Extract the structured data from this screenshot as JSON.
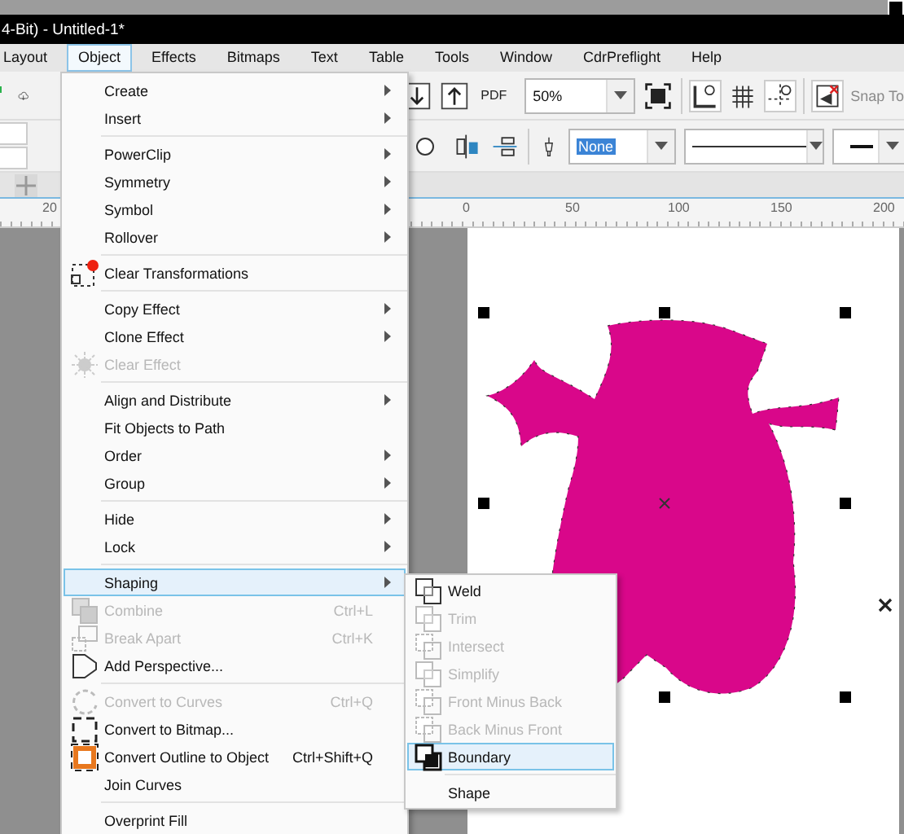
{
  "title_bar": {
    "title": "4-Bit) - Untitled-1*"
  },
  "menu_bar": [
    {
      "label": "Layout",
      "selected": false
    },
    {
      "label": "Object",
      "selected": true
    },
    {
      "label": "Effects",
      "selected": false
    },
    {
      "label": "Bitmaps",
      "selected": false
    },
    {
      "label": "Text",
      "selected": false
    },
    {
      "label": "Table",
      "selected": false
    },
    {
      "label": "Tools",
      "selected": false
    },
    {
      "label": "Window",
      "selected": false
    },
    {
      "label": "CdrPreflight",
      "selected": false
    },
    {
      "label": "Help",
      "selected": false
    }
  ],
  "toolbar": {
    "pdf_label": "PDF",
    "zoom": "50%",
    "snap": {
      "label": "Snap To",
      "disabled": true
    }
  },
  "property_bar": {
    "outline": {
      "value": "None",
      "selected": true
    }
  },
  "ruler": {
    "labels": [
      "20",
      "0",
      "50",
      "100",
      "150",
      "200"
    ]
  },
  "object_menu": {
    "items": [
      {
        "kind": "item",
        "label": "Create",
        "submenu": true,
        "disabled": false,
        "selected": false
      },
      {
        "kind": "item",
        "label": "Insert",
        "submenu": true,
        "disabled": false,
        "selected": false
      },
      {
        "kind": "separator"
      },
      {
        "kind": "item",
        "label": "PowerClip",
        "submenu": true,
        "disabled": false,
        "selected": false
      },
      {
        "kind": "item",
        "label": "Symmetry",
        "submenu": true,
        "disabled": false,
        "selected": false
      },
      {
        "kind": "item",
        "label": "Symbol",
        "submenu": true,
        "disabled": false,
        "selected": false
      },
      {
        "kind": "item",
        "label": "Rollover",
        "submenu": true,
        "disabled": false,
        "selected": false
      },
      {
        "kind": "separator"
      },
      {
        "kind": "item",
        "label": "Clear Transformations",
        "submenu": false,
        "disabled": false,
        "selected": false
      },
      {
        "kind": "separator"
      },
      {
        "kind": "item",
        "label": "Copy Effect",
        "submenu": true,
        "disabled": false,
        "selected": false
      },
      {
        "kind": "item",
        "label": "Clone Effect",
        "submenu": true,
        "disabled": false,
        "selected": false
      },
      {
        "kind": "item",
        "label": "Clear Effect",
        "submenu": false,
        "disabled": true,
        "selected": false
      },
      {
        "kind": "separator"
      },
      {
        "kind": "item",
        "label": "Align and Distribute",
        "submenu": true,
        "disabled": false,
        "selected": false
      },
      {
        "kind": "item",
        "label": "Fit Objects to Path",
        "submenu": false,
        "disabled": false,
        "selected": false
      },
      {
        "kind": "item",
        "label": "Order",
        "submenu": true,
        "disabled": false,
        "selected": false
      },
      {
        "kind": "item",
        "label": "Group",
        "submenu": true,
        "disabled": false,
        "selected": false
      },
      {
        "kind": "separator"
      },
      {
        "kind": "item",
        "label": "Hide",
        "submenu": true,
        "disabled": false,
        "selected": false
      },
      {
        "kind": "item",
        "label": "Lock",
        "submenu": true,
        "disabled": false,
        "selected": false
      },
      {
        "kind": "separator"
      },
      {
        "kind": "item",
        "label": "Shaping",
        "submenu": true,
        "disabled": false,
        "selected": true
      },
      {
        "kind": "item",
        "label": "Combine",
        "shortcut": "Ctrl+L",
        "submenu": false,
        "disabled": true,
        "selected": false
      },
      {
        "kind": "item",
        "label": "Break Apart",
        "shortcut": "Ctrl+K",
        "submenu": false,
        "disabled": true,
        "selected": false
      },
      {
        "kind": "item",
        "label": "Add Perspective...",
        "submenu": false,
        "disabled": false,
        "selected": false
      },
      {
        "kind": "separator"
      },
      {
        "kind": "item",
        "label": "Convert to Curves",
        "shortcut": "Ctrl+Q",
        "submenu": false,
        "disabled": true,
        "selected": false
      },
      {
        "kind": "item",
        "label": "Convert to Bitmap...",
        "submenu": false,
        "disabled": false,
        "selected": false
      },
      {
        "kind": "item",
        "label": "Convert Outline to Object",
        "shortcut": "Ctrl+Shift+Q",
        "submenu": false,
        "disabled": false,
        "selected": false
      },
      {
        "kind": "item",
        "label": "Join Curves",
        "submenu": false,
        "disabled": false,
        "selected": false
      },
      {
        "kind": "separator"
      },
      {
        "kind": "item",
        "label": "Overprint Fill",
        "submenu": false,
        "disabled": false,
        "selected": false
      }
    ]
  },
  "shaping_menu": {
    "items": [
      {
        "kind": "item",
        "label": "Weld",
        "disabled": false,
        "selected": false
      },
      {
        "kind": "item",
        "label": "Trim",
        "disabled": true,
        "selected": false
      },
      {
        "kind": "item",
        "label": "Intersect",
        "disabled": true,
        "selected": false
      },
      {
        "kind": "item",
        "label": "Simplify",
        "disabled": true,
        "selected": false
      },
      {
        "kind": "item",
        "label": "Front Minus Back",
        "disabled": true,
        "selected": false
      },
      {
        "kind": "item",
        "label": "Back Minus Front",
        "disabled": true,
        "selected": false
      },
      {
        "kind": "item",
        "label": "Boundary",
        "disabled": false,
        "selected": true
      },
      {
        "kind": "separator"
      },
      {
        "kind": "item",
        "label": "Shape",
        "disabled": false,
        "selected": false
      }
    ]
  }
}
